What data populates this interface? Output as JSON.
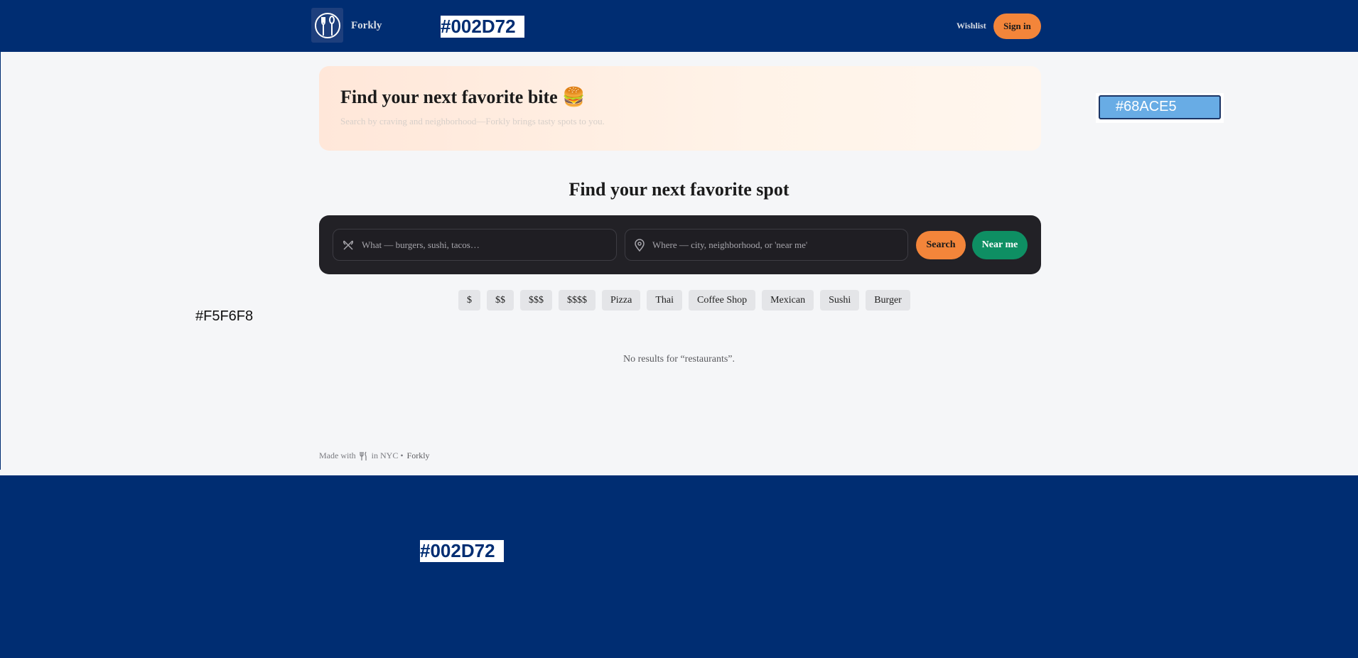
{
  "header": {
    "brand": "Forkly",
    "wishlist_label": "Wishlist",
    "signin_label": "Sign in",
    "color_label": "#002D72"
  },
  "hero": {
    "title": "Find your next favorite bite 🍔",
    "subtitle": "Search by craving and neighborhood—Forkly brings tasty spots to you."
  },
  "main": {
    "title": "Find your next favorite spot",
    "what_placeholder": "What — burgers, sushi, tacos…",
    "where_placeholder": "Where — city, neighborhood, or 'near me'",
    "search_label": "Search",
    "near_label": "Near me",
    "chips": [
      "$",
      "$$",
      "$$$",
      "$$$$",
      "Pizza",
      "Thai",
      "Coffee Shop",
      "Mexican",
      "Sushi",
      "Burger"
    ],
    "no_results": "No results for “restaurants”."
  },
  "footer": {
    "made_with": "Made with",
    "in_nyc": "in NYC •",
    "brand": "Forkly"
  },
  "swatches": {
    "light_label": "#F5F6F8",
    "blue_label": "#68ACE5",
    "bottom_label": "#002D72"
  },
  "colors": {
    "navy": "#002D72",
    "light_bg": "#F5F6F8",
    "accent_blue": "#68ACE5",
    "orange": "#F3853A",
    "green": "#0E8F63",
    "dark_bar": "#222126"
  }
}
